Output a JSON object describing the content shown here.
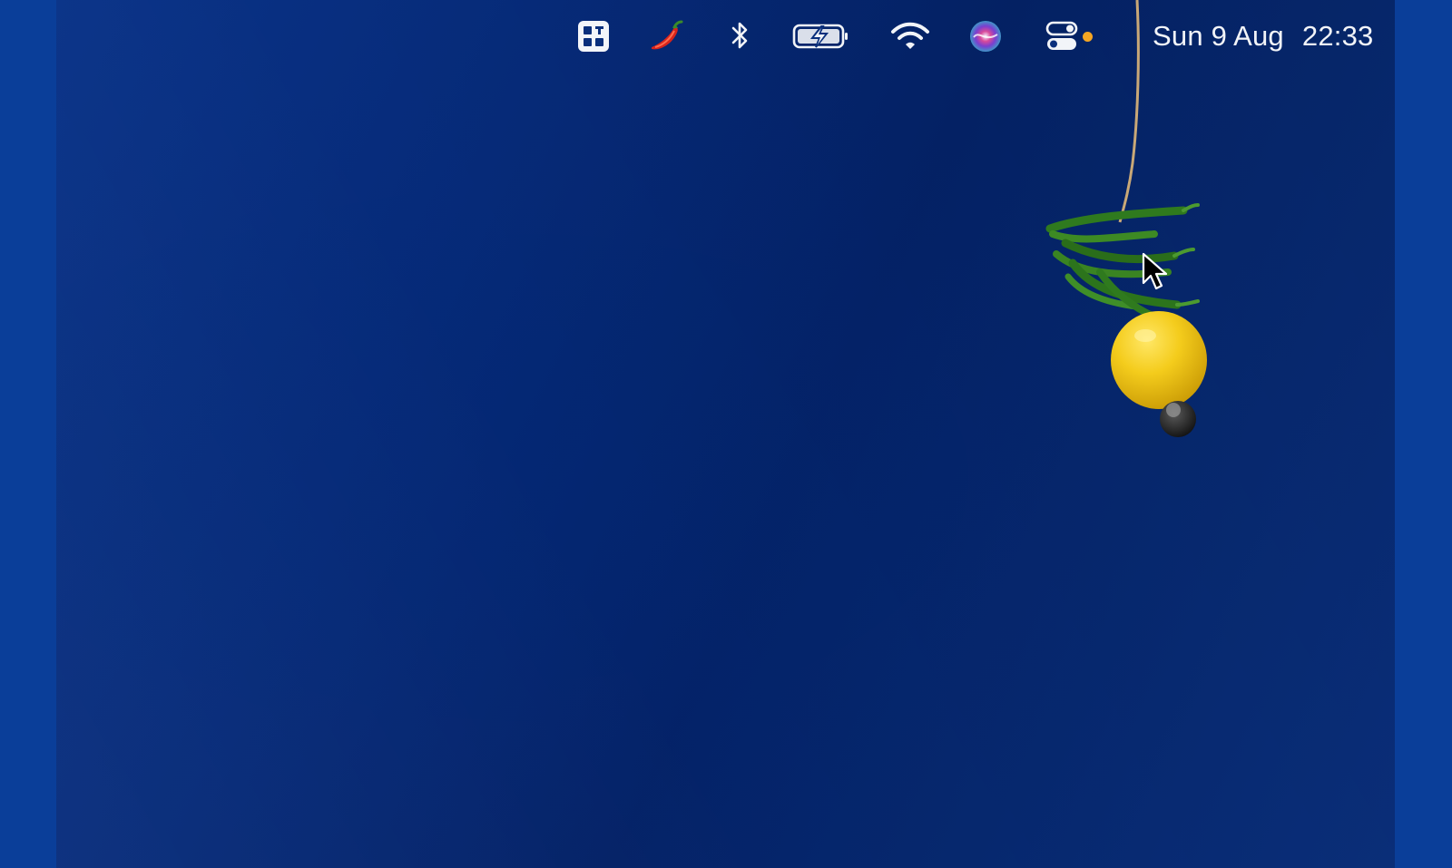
{
  "menubar": {
    "clock": {
      "date": "Sun 9 Aug",
      "time": "22:33"
    },
    "icons": [
      "menubar-app-icon",
      "chili-pepper-icon",
      "bluetooth-icon",
      "battery-charging-icon",
      "wifi-icon",
      "siri-icon",
      "control-center-icon"
    ],
    "indicator_color": "#f5a623"
  },
  "desktop": {
    "wallpaper_colors": [
      "#0a3388",
      "#042267"
    ],
    "wallpaper_items": [
      "string",
      "green-chilies",
      "lemon",
      "black-pepper"
    ]
  }
}
